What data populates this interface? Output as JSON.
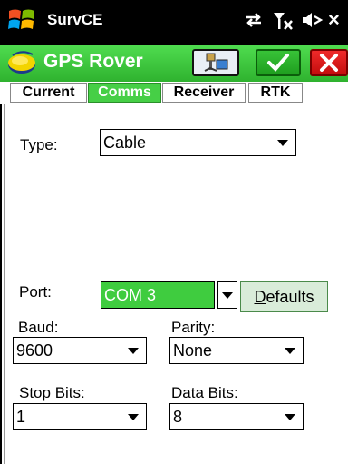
{
  "titlebar": {
    "app_name": "SurvCE",
    "close_label": "×"
  },
  "header": {
    "title": "GPS Rover"
  },
  "tabs": [
    {
      "label": "Current",
      "active": false
    },
    {
      "label": "Comms",
      "active": true
    },
    {
      "label": "Receiver",
      "active": false
    },
    {
      "label": "RTK",
      "active": false
    }
  ],
  "form": {
    "type": {
      "label": "Type:",
      "value": "Cable"
    },
    "port": {
      "label": "Port:",
      "value": "COM 3"
    },
    "defaults_button": {
      "underlined": "D",
      "rest": "efaults"
    },
    "baud": {
      "label": "Baud:",
      "value": "9600"
    },
    "parity": {
      "label": "Parity:",
      "value": "None"
    },
    "stop_bits": {
      "label": "Stop Bits:",
      "value": "1"
    },
    "data_bits": {
      "label": "Data Bits:",
      "value": "8"
    }
  },
  "colors": {
    "accent_green": "#46cf46",
    "cancel_red": "#e01818",
    "titlebar": "#000000"
  }
}
